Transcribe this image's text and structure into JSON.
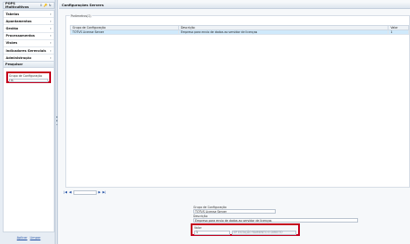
{
  "sidebar": {
    "title": "POPS Multicultivos",
    "tools": [
      "↕",
      "🔑",
      "↻"
    ],
    "menu": [
      {
        "label": "Tabelas",
        "arrow": "›"
      },
      {
        "label": "Apontamentos",
        "arrow": "›"
      },
      {
        "label": "Gestão",
        "arrow": "›"
      },
      {
        "label": "Processamentos",
        "arrow": "›"
      },
      {
        "label": "Visões",
        "arrow": "›"
      },
      {
        "label": "Indicadores Gerenciais",
        "arrow": "›"
      },
      {
        "label": "Administração",
        "arrow": "›"
      }
    ],
    "search_title": "Pesquisar",
    "search_label": "Grupo de Configuração",
    "search_value": "IS",
    "footer": {
      "filter": "Aplicar",
      "clear": "Limpar"
    }
  },
  "main": {
    "title": "Configurações Servers",
    "params_legend": "Parâmetros(1)",
    "columns": [
      "Grupo de Configuração",
      "Descrição",
      "Valor"
    ],
    "rows": [
      [
        "TOTVS License Server",
        "Empresa para envio de dados ao servidor de licenças",
        "1"
      ]
    ],
    "pager": {
      "first": "|◀",
      "prev": "◀",
      "page": "",
      "next": "▶",
      "last": "▶|"
    },
    "form": {
      "group_label": "Grupo de Configuração",
      "group_value": "TOTVS License Server",
      "desc_label": "Descrição",
      "desc_value": "Empresa para envio de dados ao servidor de licenças",
      "valor_label": "Valor",
      "valor_value": "1",
      "valor_desc": "EP ESTAÇÃO RAIMENTO E DIREITO"
    }
  }
}
